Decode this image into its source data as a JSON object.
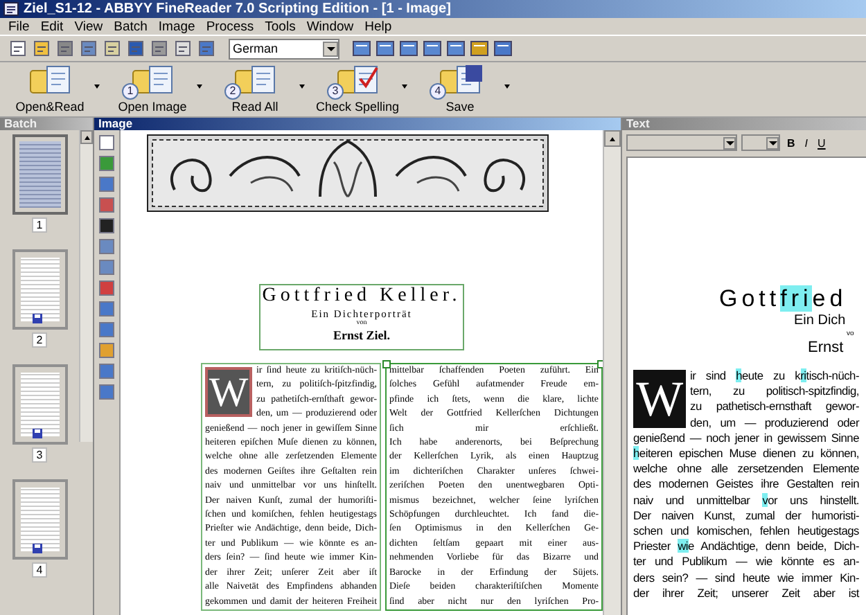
{
  "window": {
    "title": "Ziel_S1-12 - ABBYY FineReader 7.0 Scripting Edition - [1 - Image]"
  },
  "menu": [
    "File",
    "Edit",
    "View",
    "Batch",
    "Image",
    "Process",
    "Tools",
    "Window",
    "Help"
  ],
  "toolbar": {
    "language": "German"
  },
  "actions": [
    {
      "label": "Open&Read"
    },
    {
      "label": "Open Image",
      "step": "1"
    },
    {
      "label": "Read All",
      "step": "2"
    },
    {
      "label": "Check Spelling",
      "step": "3"
    },
    {
      "label": "Save",
      "step": "4"
    }
  ],
  "batch": {
    "title": "Batch",
    "active": false,
    "pages": [
      {
        "label": "1",
        "selected": true,
        "saved": false
      },
      {
        "label": "2",
        "selected": false,
        "saved": true
      },
      {
        "label": "3",
        "selected": false,
        "saved": true
      },
      {
        "label": "4",
        "selected": false,
        "saved": true
      }
    ]
  },
  "image": {
    "title": "Image",
    "active": true,
    "heading": "Gottfried Keller.",
    "subtitle": "Ein Dichterporträt",
    "by": "von",
    "author": "Ernst Ziel.",
    "drop_cap": "W",
    "column_1": [
      "ir ſind heute zu kritiſch-nüch-",
      "tern, zu politiſch-ſpitzfindig,",
      "zu pathetiſch-ernſthaft gewor-",
      "den, um — produzierend oder",
      "genießend — noch jener in gewiſſem Sinne",
      "heiteren epiſchen Muſe dienen zu können,",
      "welche ohne alle zerſetzenden Elemente",
      "des modernen Geiſtes ihre Geſtalten rein",
      "naiv und unmittelbar vor uns hinſtellt.",
      "Der naiven Kunſt, zumal der humoriſti-",
      "ſchen und komiſchen, fehlen heutigestags",
      "Prieſter wie Andächtige, denn beide, Dich-",
      "ter und Publikum — wie könnte es an-",
      "ders ſein? — ſind heute wie immer Kin-",
      "der ihrer Zeit; unſerer Zeit aber iſt",
      "alle Naivetät des Empfindens abhanden",
      "gekommen und damit der heiteren Freiheit"
    ],
    "column_2": [
      "mittelbar ſchaffenden Poeten zuführt. Ein",
      "ſolches Gefühl aufatmender Freude em-",
      "pfinde ich ſtets, wenn die klare, lichte",
      "Welt der Gottfried Kellerſchen Dichtungen",
      "ſich mir erſchließt.",
      "Ich habe anderenorts, bei Beſprechung",
      "der Kellerſchen Lyrik, als einen Hauptzug",
      "im dichteriſchen Charakter unſeres ſchwei-",
      "zeriſchen Poeten den unentwegbaren Opti-",
      "mismus bezeichnet, welcher ſeine lyriſchen",
      "Schöpfungen durchleuchtet. Ich fand die-",
      "ſen Optimismus in den Kellerſchen Ge-",
      "dichten ſeltſam gepaart mit einer aus-",
      "nehmenden Vorliebe für das Bizarre und",
      "Barocke in der Erfindung der Süjets.",
      "Dieſe beiden charakteriſtiſchen Momente",
      "ſind aber nicht nur den lyriſchen Pro-"
    ]
  },
  "text_panel": {
    "title": "Text",
    "active": false,
    "format_buttons": [
      "B",
      "I",
      "U"
    ],
    "heading": [
      {
        "text": "Gott",
        "flagged": false
      },
      {
        "text": "fri",
        "flagged": true
      },
      {
        "text": "ed",
        "flagged": false
      }
    ],
    "subtitle": "Ein Dich",
    "by": "vo",
    "author": "Ernst",
    "drop_cap": "W",
    "lines": [
      [
        {
          "text": "ir sind ",
          "flagged": false
        },
        {
          "text": "h",
          "flagged": true
        },
        {
          "text": "eute zu k",
          "flagged": false
        },
        {
          "text": "ri",
          "flagged": true
        },
        {
          "text": "tisch-nüch-",
          "flagged": false
        }
      ],
      [
        {
          "text": "tern, zu politisch-spitzfindig,",
          "flagged": false
        }
      ],
      [
        {
          "text": "zu pathetisch-ernsthaft gewor-",
          "flagged": false
        }
      ],
      [
        {
          "text": "den, um — produzierend oder",
          "flagged": false
        }
      ],
      [
        {
          "text": "genießend — noch jener in gewissem Sinne",
          "flagged": false
        }
      ],
      [
        {
          "text": "h",
          "flagged": true
        },
        {
          "text": "eiteren epischen Muse dienen zu können,",
          "flagged": false
        }
      ],
      [
        {
          "text": "welche ohne alle zersetzenden Elemente",
          "flagged": false
        }
      ],
      [
        {
          "text": "des modernen Geistes ihre Gestalten rein",
          "flagged": false
        }
      ],
      [
        {
          "text": "naiv und unmittelbar ",
          "flagged": false
        },
        {
          "text": "v",
          "flagged": true
        },
        {
          "text": "or uns hinstellt.",
          "flagged": false
        }
      ],
      [
        {
          "text": "Der naiven Kunst, zumal der humoristi-",
          "flagged": false
        }
      ],
      [
        {
          "text": "schen und komischen, fehlen heutigestags",
          "flagged": false
        }
      ],
      [
        {
          "text": "Priester ",
          "flagged": false
        },
        {
          "text": "wi",
          "flagged": true
        },
        {
          "text": "e Andächtige, denn beide, Dich-",
          "flagged": false
        }
      ],
      [
        {
          "text": "ter und Publikum — wie könnte es an-",
          "flagged": false
        }
      ],
      [
        {
          "text": "ders sein? — sind heute wie immer Kin-",
          "flagged": false
        }
      ],
      [
        {
          "text": "der ihrer Zeit; unserer Zeit aber ist",
          "flagged": false
        }
      ]
    ]
  }
}
